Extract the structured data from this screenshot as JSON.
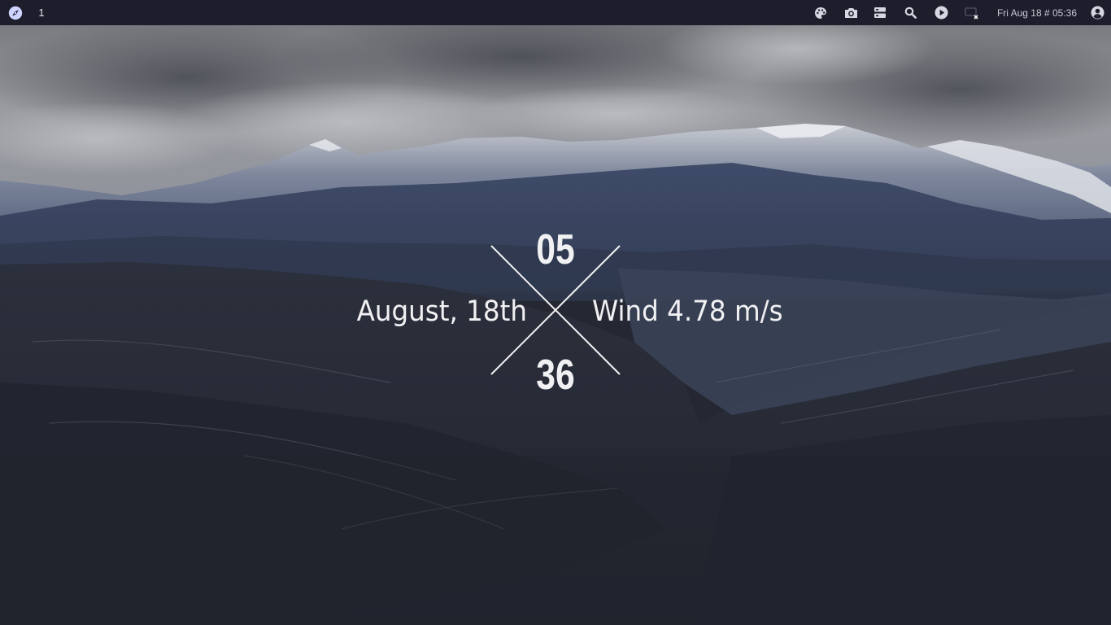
{
  "topbar": {
    "launcher_icon": "compass-icon",
    "workspace": "1",
    "tray_icons": [
      "palette-icon",
      "camera-icon",
      "server-icon",
      "search-icon",
      "play-circle-icon",
      "screen-off-icon",
      "user-circle-icon"
    ],
    "clock": "Fri Aug 18 # 05:36"
  },
  "widget": {
    "hour": "05",
    "minute": "36",
    "date": "August, 18th",
    "weather": "Wind 4.78 m/s"
  },
  "colors": {
    "bar_bg": "#1d1d2b",
    "bar_fg": "#d4d6e1",
    "accent_icon": "#cfd3ff",
    "widget_text": "#f1f1f3"
  }
}
